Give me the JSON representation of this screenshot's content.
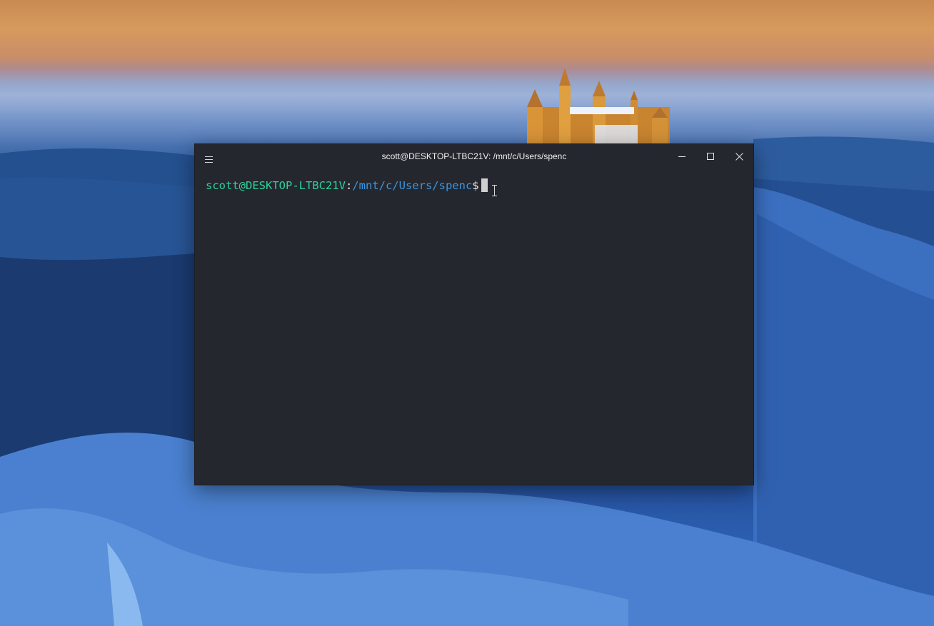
{
  "desktop": {
    "wallpaper": "winter-castle-landscape",
    "colors": {
      "sky_top": "#d79a5d",
      "forest": "#1c3e7a",
      "snow_trees": "#4f86d4"
    }
  },
  "terminal": {
    "title": "scott@DESKTOP-LTBC21V: /mnt/c/Users/spenc",
    "prompt": {
      "user_host": "scott@DESKTOP-LTBC21V",
      "separator": ":",
      "path": "/mnt/c/Users/spenc",
      "symbol": "$"
    },
    "input_value": "",
    "icons": {
      "menu": "hamburger-menu-icon",
      "minimize": "minimize-icon",
      "maximize": "maximize-icon",
      "close": "close-icon",
      "text_cursor": "i-beam-cursor-icon"
    },
    "colors": {
      "background": "#24272e",
      "user_host": "#2fd19a",
      "path": "#3b95e0",
      "text": "#e6e6e6"
    }
  }
}
